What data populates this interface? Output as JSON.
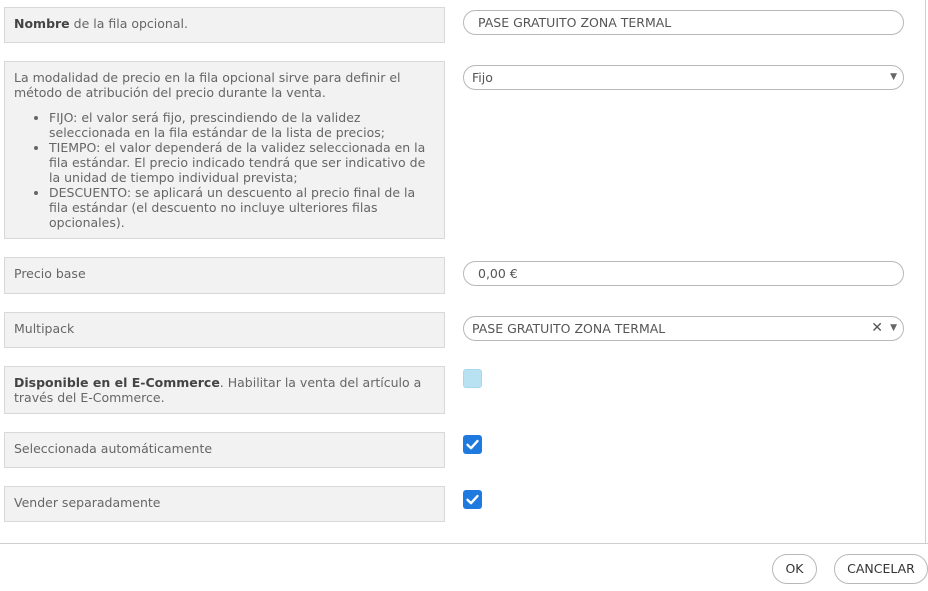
{
  "rows": {
    "name": {
      "label_bold": "Nombre",
      "label_rest": " de la fila opcional.",
      "value": "PASE GRATUITO ZONA TERMAL"
    },
    "price_mode": {
      "intro": "La modalidad de precio en la fila opcional sirve para definir el método de atribución del precio durante la venta.",
      "bullets": [
        "FIJO: el valor será fijo, prescindiendo de la validez seleccionada en la fila estándar de la lista de precios;",
        "TIEMPO: el valor dependerá de la validez seleccionada en la fila estándar. El precio indicado tendrá que ser indicativo de la unidad de tiempo individual prevista;",
        "DESCUENTO: se aplicará un descuento al precio final de la fila estándar (el descuento no incluye ulteriores filas opcionales)."
      ],
      "selected": "Fijo"
    },
    "base_price": {
      "label": "Precio base",
      "value": "0,00 €"
    },
    "multipack": {
      "label": "Multipack",
      "selected": "PASE GRATUITO ZONA TERMAL"
    },
    "ecommerce": {
      "label_bold": "Disponible en el E-Commerce",
      "label_rest": ". Habilitar la venta del artículo a través del E-Commerce.",
      "checked": false
    },
    "auto_selected": {
      "label": "Seleccionada automáticamente",
      "checked": true
    },
    "sell_separately": {
      "label": "Vender separadamente",
      "checked": true
    }
  },
  "icons": {
    "dropdown": "▼",
    "clear": "✕"
  },
  "buttons": {
    "ok": "OK",
    "cancel": "CANCELAR"
  },
  "colors": {
    "checkbox_checked": "#1f7ae0",
    "checkbox_unchecked": "#b8e2f2",
    "label_bg": "#f2f2f2"
  }
}
